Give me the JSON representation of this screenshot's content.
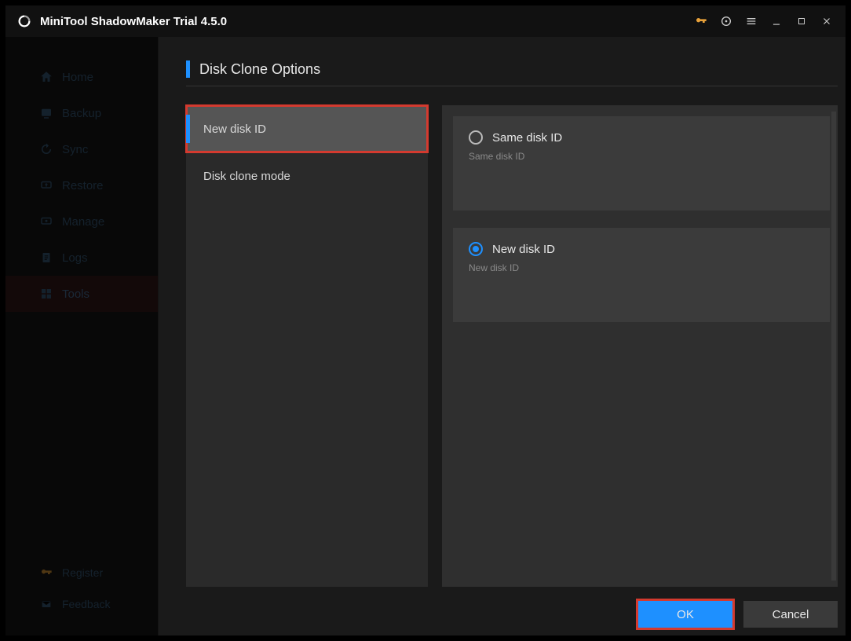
{
  "window": {
    "title": "MiniTool ShadowMaker Trial 4.5.0"
  },
  "sidebar": {
    "items": [
      {
        "label": "Home"
      },
      {
        "label": "Backup"
      },
      {
        "label": "Sync"
      },
      {
        "label": "Restore"
      },
      {
        "label": "Manage"
      },
      {
        "label": "Logs"
      },
      {
        "label": "Tools"
      }
    ],
    "bottom": [
      {
        "label": "Register"
      },
      {
        "label": "Feedback"
      }
    ]
  },
  "dialog": {
    "title": "Disk Clone Options",
    "left_options": [
      {
        "label": "New disk ID",
        "selected": true
      },
      {
        "label": "Disk clone mode",
        "selected": false
      }
    ],
    "radio_options": [
      {
        "label": "Same disk ID",
        "desc": "Same disk ID",
        "checked": false
      },
      {
        "label": "New disk ID",
        "desc": "New disk ID",
        "checked": true
      }
    ],
    "ok_label": "OK",
    "cancel_label": "Cancel"
  }
}
